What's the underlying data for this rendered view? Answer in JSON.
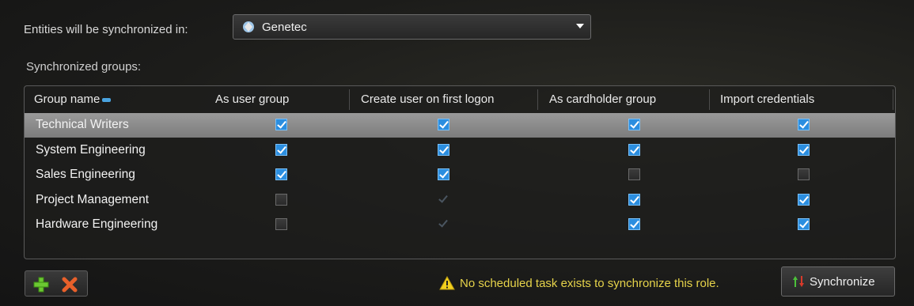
{
  "top": {
    "entities_label": "Entities will be synchronized in:",
    "partition_value": "Genetec"
  },
  "synchronized_groups_label": "Synchronized groups:",
  "table": {
    "columns": [
      "Group name",
      "As user group",
      "Create user on first logon",
      "As cardholder group",
      "Import credentials"
    ],
    "rows": [
      {
        "name": "Technical Writers",
        "as_user_group": "checked",
        "create_user_on_first_logon": "checked",
        "as_cardholder_group": "checked",
        "import_credentials": "checked",
        "selected": true
      },
      {
        "name": "System Engineering",
        "as_user_group": "checked",
        "create_user_on_first_logon": "checked",
        "as_cardholder_group": "checked",
        "import_credentials": "checked",
        "selected": false
      },
      {
        "name": "Sales Engineering",
        "as_user_group": "checked",
        "create_user_on_first_logon": "checked",
        "as_cardholder_group": "unchecked",
        "import_credentials": "unchecked",
        "selected": false
      },
      {
        "name": "Project Management",
        "as_user_group": "unchecked",
        "create_user_on_first_logon": "disabled-checked",
        "as_cardholder_group": "checked",
        "import_credentials": "checked",
        "selected": false
      },
      {
        "name": "Hardware Engineering",
        "as_user_group": "unchecked",
        "create_user_on_first_logon": "disabled-checked",
        "as_cardholder_group": "checked",
        "import_credentials": "checked",
        "selected": false
      }
    ]
  },
  "footer": {
    "add_icon": "plus-icon",
    "remove_icon": "x-icon",
    "warning_icon": "warning-triangle-icon",
    "warning_text": "No scheduled task exists to synchronize this role.",
    "synchronize_label": "Synchronize"
  },
  "colors": {
    "check_blue": "#2b8ee0",
    "warning_yellow": "#e6d34a",
    "selected_row": "#8a8a8a"
  }
}
